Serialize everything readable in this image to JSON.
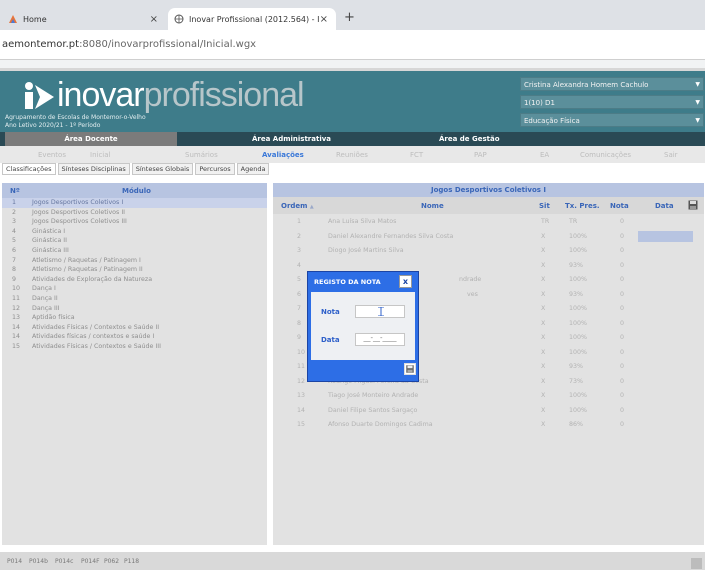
{
  "browser": {
    "tabs": [
      {
        "label": "Home",
        "close": "×"
      },
      {
        "label": "Inovar Profissional (2012.564) - I",
        "close": "×"
      }
    ],
    "new_tab": "+",
    "url_host": "aemontemor.pt",
    "url_path": ":8080/inovarprofissional/Inicial.wgx"
  },
  "header": {
    "logo_bold": "inovar",
    "logo_light": "profissional",
    "school": "Agrupamento de Escolas de Montemor-o-Velho",
    "year": "Ano Letivo 2020/21 - 1º Período",
    "user": "Cristina Alexandra Homem Cachulo",
    "class": "1(10) D1",
    "subject": "Educação Física"
  },
  "menu": {
    "areas": [
      "Área Docente",
      "Área Administrativa",
      "Área de Gestão"
    ],
    "items": [
      "Eventos",
      "Inicial",
      "Sumários",
      "Avaliações",
      "Reuniões",
      "FCT",
      "PAP",
      "EA",
      "Comunicações",
      "Sair"
    ],
    "subtabs": [
      "Classificações",
      "Sínteses Disciplinas",
      "Sínteses Globais",
      "Percursos",
      "Agenda"
    ]
  },
  "modules": {
    "headers": [
      "Nº",
      "Módulo"
    ],
    "rows": [
      {
        "n": "1",
        "name": "Jogos Desportivos Coletivos I"
      },
      {
        "n": "2",
        "name": "Jogos Desportivos Coletivos II"
      },
      {
        "n": "3",
        "name": "Jogos Desportivos Coletivos III"
      },
      {
        "n": "4",
        "name": "Ginástica I"
      },
      {
        "n": "5",
        "name": "Ginástica II"
      },
      {
        "n": "6",
        "name": "Ginástica III"
      },
      {
        "n": "7",
        "name": "Atletismo / Raquetas / Patinagem I"
      },
      {
        "n": "8",
        "name": "Atletismo / Raquetas / Patinagem II"
      },
      {
        "n": "9",
        "name": "Atividades de Exploração da Natureza"
      },
      {
        "n": "10",
        "name": "Dança I"
      },
      {
        "n": "11",
        "name": "Dança II"
      },
      {
        "n": "12",
        "name": "Dança III"
      },
      {
        "n": "13",
        "name": "Aptidão física"
      },
      {
        "n": "14",
        "name": "Atividades Físicas / Contextos e Saúde II"
      },
      {
        "n": "14",
        "name": "Atividades físicas / contextos e saúde I"
      },
      {
        "n": "15",
        "name": "Atividades Físicas / Contextos e Saúde III"
      }
    ]
  },
  "students": {
    "title": "Jogos Desportivos Coletivos I",
    "headers": [
      "Ordem",
      "Nome",
      "Sit",
      "Tx. Pres.",
      "Nota",
      "Data"
    ],
    "sort_indicator": "▲",
    "rows": [
      {
        "ordem": "1",
        "nome": "Ana Luísa Silva Matos",
        "sit": "TR",
        "tx": "TR",
        "nota": "0"
      },
      {
        "ordem": "2",
        "nome": "Daniel Alexandre Fernandes Silva Costa",
        "sit": "X",
        "tx": "100%",
        "nota": "0"
      },
      {
        "ordem": "3",
        "nome": "Diogo José Martins Silva",
        "sit": "X",
        "tx": "100%",
        "nota": "0"
      },
      {
        "ordem": "4",
        "nome": "",
        "sit": "X",
        "tx": "93%",
        "nota": "0"
      },
      {
        "ordem": "5",
        "nome": "ndrade",
        "sit": "X",
        "tx": "100%",
        "nota": "0"
      },
      {
        "ordem": "6",
        "nome": "ves",
        "sit": "X",
        "tx": "93%",
        "nota": "0"
      },
      {
        "ordem": "7",
        "nome": "",
        "sit": "X",
        "tx": "100%",
        "nota": "0"
      },
      {
        "ordem": "8",
        "nome": "",
        "sit": "X",
        "tx": "100%",
        "nota": "0"
      },
      {
        "ordem": "9",
        "nome": "",
        "sit": "X",
        "tx": "100%",
        "nota": "0"
      },
      {
        "ordem": "10",
        "nome": "",
        "sit": "X",
        "tx": "100%",
        "nota": "0"
      },
      {
        "ordem": "11",
        "nome": "",
        "sit": "X",
        "tx": "93%",
        "nota": "0"
      },
      {
        "ordem": "12",
        "nome": "Rodrigo Miguel Pereira da Costa",
        "sit": "X",
        "tx": "73%",
        "nota": "0"
      },
      {
        "ordem": "13",
        "nome": "Tiago José Monteiro Andrade",
        "sit": "X",
        "tx": "100%",
        "nota": "0"
      },
      {
        "ordem": "14",
        "nome": "Daniel Filipe Santos Sargaço",
        "sit": "X",
        "tx": "100%",
        "nota": "0"
      },
      {
        "ordem": "15",
        "nome": "Afonso Duarte Domingos Cadima",
        "sit": "X",
        "tx": "86%",
        "nota": "0"
      }
    ]
  },
  "dialog": {
    "title": "REGISTO DA NOTA",
    "close": "x",
    "nota_label": "Nota",
    "nota_value": "",
    "data_label": "Data",
    "data_value": "__-__-____"
  },
  "footer": {
    "codes": [
      "P014",
      "P014b",
      "P014c",
      "P014F",
      "P062",
      "P118"
    ]
  },
  "colors": {
    "header_bg": "#3e7c8a",
    "dialog_bg": "#2d6ee6",
    "table_header": "#b7c4e1"
  }
}
